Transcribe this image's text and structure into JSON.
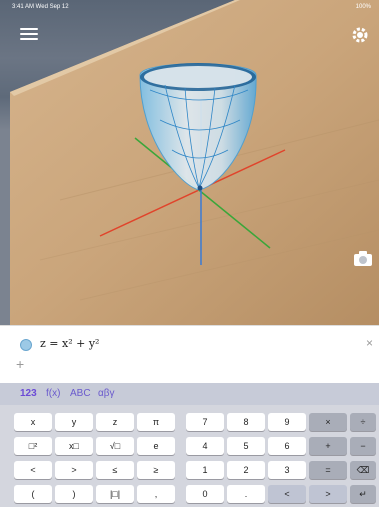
{
  "status_bar": {
    "time": "3:41 AM  Wed Sep 12",
    "battery": "100%"
  },
  "scene": {
    "menu_icon": "hamburger-menu-icon",
    "settings_icon": "gear-icon",
    "camera_icon": "camera-icon"
  },
  "algebra": {
    "equation": "z = x² + y²",
    "close": "×",
    "add": "+"
  },
  "keyboard_tabs": [
    "123",
    "f(x)",
    "ABC",
    "αβγ"
  ],
  "keys": {
    "row1": [
      "x",
      "y",
      "z",
      "π",
      "7",
      "8",
      "9",
      "×",
      "÷"
    ],
    "row2": [
      "□²",
      "x□",
      "√□",
      "e",
      "4",
      "5",
      "6",
      "+",
      "−"
    ],
    "row3": [
      "<",
      ">",
      "≤",
      "≥",
      "1",
      "2",
      "3",
      "=",
      "⌫"
    ],
    "row4": [
      "(",
      ")",
      "|□|",
      ",",
      "0",
      ".",
      "<",
      ">",
      "↵"
    ]
  },
  "colors": {
    "accent": "#6c4bd6",
    "surface": "#9cc9e6",
    "x_axis": "#e0442b",
    "y_axis": "#3aa63a",
    "z_axis": "#3a7bd5"
  }
}
